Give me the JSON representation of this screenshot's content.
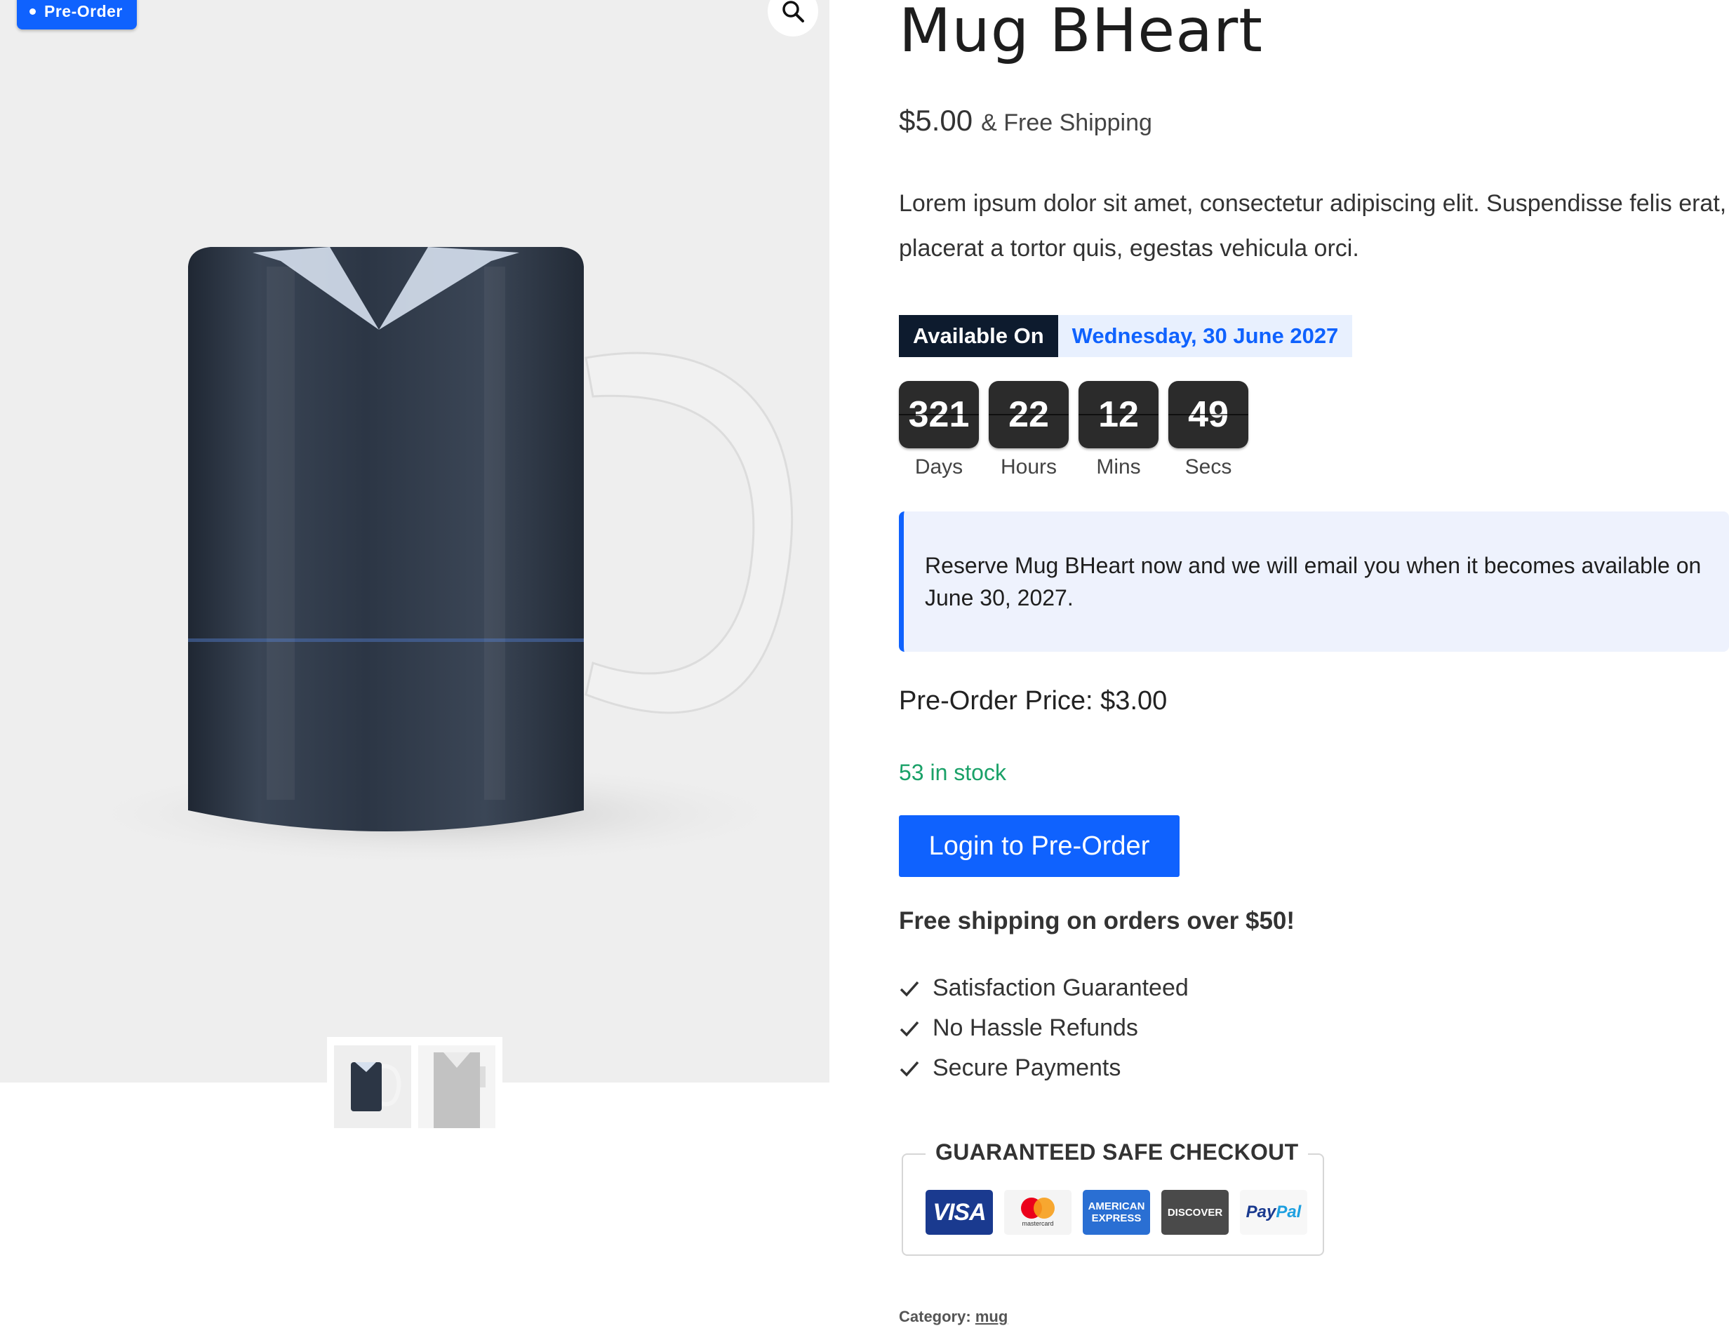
{
  "badge": {
    "label": "Pre-Order"
  },
  "gallery": {
    "zoom_icon": "magnifier-icon"
  },
  "product": {
    "title": "Mug BHeart",
    "price": "$5.00",
    "shipping_note": "& Free Shipping",
    "description": "Lorem ipsum dolor sit amet, consectetur adipiscing elit. Suspendisse felis erat, placerat a tortor quis, egestas vehicula orci."
  },
  "availability": {
    "label": "Available On",
    "date": "Wednesday, 30 June 2027"
  },
  "countdown": [
    {
      "value": "321",
      "label": "Days"
    },
    {
      "value": "22",
      "label": "Hours"
    },
    {
      "value": "12",
      "label": "Mins"
    },
    {
      "value": "49",
      "label": "Secs"
    }
  ],
  "notice": {
    "text": "Reserve Mug BHeart now and we will email you when it becomes available on June 30, 2027."
  },
  "preorder_price": "Pre-Order Price: $3.00",
  "stock": "53 in stock",
  "cta": {
    "label": "Login to Pre-Order"
  },
  "free_shipping": "Free shipping on orders over $50!",
  "features": [
    "Satisfaction Guaranteed",
    "No Hassle Refunds",
    "Secure Payments"
  ],
  "checkout": {
    "title": "GUARANTEED SAFE CHECKOUT",
    "cards": {
      "visa": "VISA",
      "mastercard": "mastercard",
      "amex_line1": "AMERICAN",
      "amex_line2": "EXPRESS",
      "discover": "DISCOVER",
      "paypal_1": "Pay",
      "paypal_2": "Pal"
    }
  },
  "category": {
    "label": "Category:",
    "value": "mug"
  },
  "colors": {
    "accent": "#0f62fe",
    "dark": "#0d1b2e",
    "stock_green": "#1aa168",
    "notice_bg": "#eef2fd",
    "gallery_bg": "#eeeeee"
  }
}
